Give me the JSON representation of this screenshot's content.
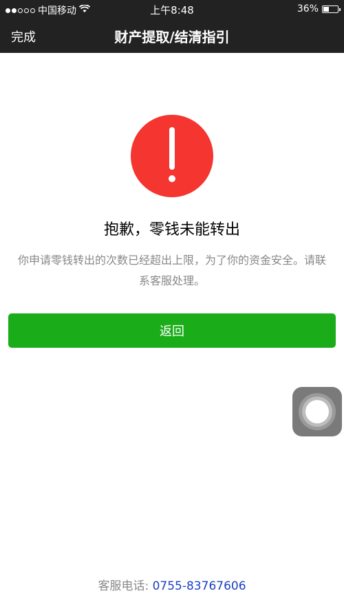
{
  "status_bar": {
    "carrier": "中国移动",
    "time": "上午8:48",
    "battery_percent": "36%",
    "battery_level": 0.36,
    "signal_bars_filled": 2,
    "signal_bars_total": 5,
    "icons": [
      "signal-dots-icon",
      "wifi-icon",
      "battery-icon"
    ]
  },
  "navbar": {
    "done_label": "完成",
    "title": "财产提取/结清指引"
  },
  "content": {
    "icon": "exclamation-circle-icon",
    "title": "抱歉，零钱未能转出",
    "description": "你申请零钱转出的次数已经超出上限，为了你的资金安全。请联系客服处理。",
    "back_button_label": "返回"
  },
  "footer": {
    "label": "客服电话: ",
    "phone": "0755-83767606"
  },
  "assistive_touch": {
    "icon": "assistive-touch-icon"
  },
  "colors": {
    "topbar_bg": "#222222",
    "warning_red": "#f43530",
    "button_green": "#1aad19",
    "text_gray": "#888888",
    "phone_blue": "#1a3fc4"
  }
}
